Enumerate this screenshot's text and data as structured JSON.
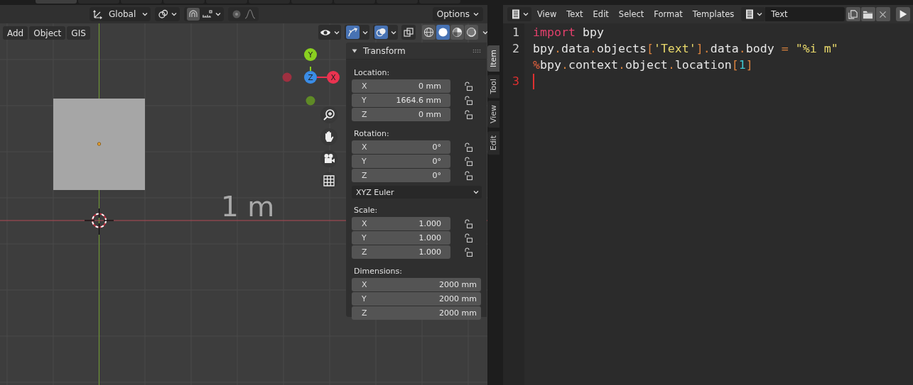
{
  "viewport": {
    "tool_header": {
      "orientation": "Global",
      "options": "Options",
      "proportional_editing": false
    },
    "menus": [
      "Add",
      "Object",
      "GIS"
    ],
    "view_toggles": [
      {
        "kind": "visibility",
        "on": false
      },
      {
        "kind": "gizmo",
        "on": true
      },
      {
        "kind": "overlay",
        "on": true
      },
      {
        "kind": "xray",
        "on": false
      }
    ],
    "shading_modes": [
      {
        "kind": "wireframe",
        "selected": false
      },
      {
        "kind": "solid",
        "selected": true
      },
      {
        "kind": "material",
        "selected": false
      },
      {
        "kind": "rendered",
        "selected": false
      }
    ],
    "text_object": "1 m",
    "gizmo_axes": [
      {
        "label": "Y"
      },
      {
        "label": "Z"
      },
      {
        "label": "X"
      }
    ],
    "sidebar": {
      "tabs": [
        {
          "label": "Item",
          "selected": true
        },
        {
          "label": "Tool",
          "selected": false
        },
        {
          "label": "View",
          "selected": false
        },
        {
          "label": "Edit",
          "selected": false
        }
      ],
      "panel": {
        "title": "Transform",
        "expanded": true,
        "groups": [
          {
            "label": "Location:",
            "fields": [
              {
                "axis": "X",
                "value": "0 mm",
                "locked": false
              },
              {
                "axis": "Y",
                "value": "1664.6 mm",
                "locked": false
              },
              {
                "axis": "Z",
                "value": "0 mm",
                "locked": false
              }
            ]
          },
          {
            "label": "Rotation:",
            "fields": [
              {
                "axis": "X",
                "value": "0°",
                "locked": false
              },
              {
                "axis": "Y",
                "value": "0°",
                "locked": false
              },
              {
                "axis": "Z",
                "value": "0°",
                "locked": false
              }
            ],
            "mode": "XYZ Euler"
          },
          {
            "label": "Scale:",
            "fields": [
              {
                "axis": "X",
                "value": "1.000",
                "locked": false
              },
              {
                "axis": "Y",
                "value": "1.000",
                "locked": false
              },
              {
                "axis": "Z",
                "value": "1.000",
                "locked": false
              }
            ]
          },
          {
            "label": "Dimensions:",
            "fields": [
              {
                "axis": "X",
                "value": "2000 mm"
              },
              {
                "axis": "Y",
                "value": "2000 mm"
              },
              {
                "axis": "Z",
                "value": "2000 mm"
              }
            ]
          }
        ]
      }
    }
  },
  "text_editor": {
    "menus": [
      "View",
      "Text",
      "Edit",
      "Select",
      "Format",
      "Templates"
    ],
    "datablock": "Text",
    "lines": [
      {
        "number": "1",
        "current": false,
        "rows": [
          [
            {
              "kind": "keyword",
              "text": "import"
            },
            {
              "kind": "name",
              "text": " bpy"
            }
          ]
        ]
      },
      {
        "number": "2",
        "current": false,
        "rows": [
          [
            {
              "kind": "name",
              "text": "bpy"
            },
            {
              "kind": "punct",
              "text": "."
            },
            {
              "kind": "name",
              "text": "data"
            },
            {
              "kind": "punct",
              "text": "."
            },
            {
              "kind": "name",
              "text": "objects"
            },
            {
              "kind": "punct",
              "text": "["
            },
            {
              "kind": "string",
              "text": "'Text'"
            },
            {
              "kind": "punct",
              "text": "]."
            },
            {
              "kind": "name",
              "text": "data"
            },
            {
              "kind": "punct",
              "text": "."
            },
            {
              "kind": "name",
              "text": "body "
            },
            {
              "kind": "punct",
              "text": "="
            },
            {
              "kind": "string",
              "text": " \"%i m\""
            }
          ],
          [
            {
              "kind": "operator",
              "text": "%"
            },
            {
              "kind": "name",
              "text": "bpy"
            },
            {
              "kind": "punct",
              "text": "."
            },
            {
              "kind": "name",
              "text": "context"
            },
            {
              "kind": "punct",
              "text": "."
            },
            {
              "kind": "name",
              "text": "object"
            },
            {
              "kind": "punct",
              "text": "."
            },
            {
              "kind": "name",
              "text": "location"
            },
            {
              "kind": "punct",
              "text": "["
            },
            {
              "kind": "number",
              "text": "1"
            },
            {
              "kind": "punct",
              "text": "]"
            }
          ]
        ]
      },
      {
        "number": "3",
        "current": true,
        "rows": [
          []
        ]
      }
    ]
  }
}
